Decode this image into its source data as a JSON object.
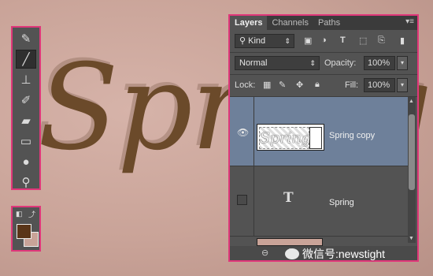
{
  "canvas": {
    "word": "Spring",
    "text_color": "#6b4a2a",
    "background": "#c9a398"
  },
  "toolbox": {
    "tools": [
      {
        "name": "spot-healing-brush",
        "glyph": "✎"
      },
      {
        "name": "brush",
        "glyph": "╱",
        "active": true
      },
      {
        "name": "clone-stamp",
        "glyph": "⊥"
      },
      {
        "name": "history-brush",
        "glyph": "✐"
      },
      {
        "name": "eraser",
        "glyph": "▰"
      },
      {
        "name": "gradient",
        "glyph": "▭"
      },
      {
        "name": "blur",
        "glyph": "●"
      },
      {
        "name": "dodge",
        "glyph": "⚲"
      }
    ],
    "foreground_color": "#5a3518",
    "background_color": "#c9a398"
  },
  "panel": {
    "tabs": [
      "Layers",
      "Channels",
      "Paths"
    ],
    "active_tab": "Layers",
    "filter_kind": "Kind",
    "blend_mode": "Normal",
    "opacity_label": "Opacity:",
    "opacity_value": "100%",
    "lock_label": "Lock:",
    "fill_label": "Fill:",
    "fill_value": "100%",
    "layers": [
      {
        "name": "Spring copy",
        "visible": true,
        "selected": true,
        "type": "text-raster",
        "thumb_text": "Spring"
      },
      {
        "name": "Spring",
        "visible": false,
        "selected": false,
        "type": "text"
      }
    ]
  },
  "watermark": "微信号:newstight",
  "accent": "#e0377a"
}
